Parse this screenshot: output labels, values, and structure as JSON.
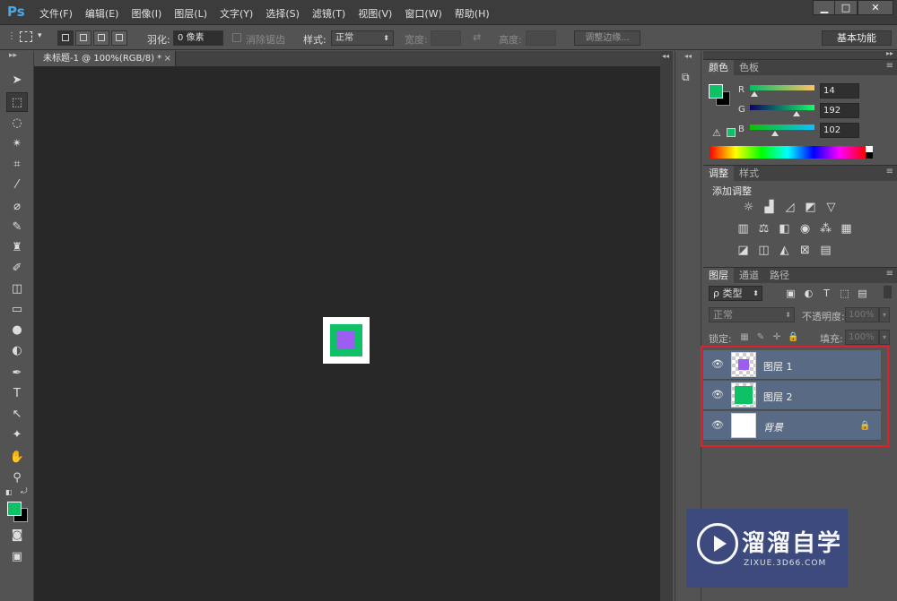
{
  "app": {
    "logo_text": "Ps",
    "menus": [
      "文件(F)",
      "编辑(E)",
      "图像(I)",
      "图层(L)",
      "文字(Y)",
      "选择(S)",
      "滤镜(T)",
      "视图(V)",
      "窗口(W)",
      "帮助(H)"
    ],
    "window_controls": [
      "▁",
      "□",
      "✕"
    ]
  },
  "options_bar": {
    "feather_label": "羽化:",
    "feather_value": "0 像素",
    "antialias_label": "消除锯齿",
    "style_label": "样式:",
    "style_value": "正常",
    "width_label": "宽度:",
    "height_label": "高度:",
    "refine_edge_label": "调整边缘...",
    "workspace_label": "基本功能"
  },
  "document": {
    "tab_title": "未标题-1 @ 100%(RGB/8) *",
    "tab_close": "×"
  },
  "colors": {
    "foreground": "#0ec066",
    "background": "#000000",
    "square_outer": "#0ec066",
    "square_inner": "#9b5ef0",
    "accent_highlight": "#e0202a"
  },
  "color_panel": {
    "tabs": [
      "颜色",
      "色板"
    ],
    "channels": [
      {
        "label": "R",
        "value": "14"
      },
      {
        "label": "G",
        "value": "192"
      },
      {
        "label": "B",
        "value": "102"
      }
    ]
  },
  "adjustments_panel": {
    "tabs": [
      "调整",
      "样式"
    ],
    "title": "添加调整"
  },
  "layers_panel": {
    "tabs": [
      "图层",
      "通道",
      "路径"
    ],
    "filter_label": "ρ 类型",
    "blend_mode": "正常",
    "opacity_label": "不透明度:",
    "opacity_value": "100%",
    "lock_label": "锁定:",
    "fill_label": "填充:",
    "fill_value": "100%",
    "layers": [
      {
        "name": "图层 1",
        "thumb": "purple"
      },
      {
        "name": "图层 2",
        "thumb": "green"
      },
      {
        "name": "背景",
        "thumb": "white",
        "locked": true
      }
    ]
  },
  "watermark": {
    "title": "溜溜自学",
    "subtitle": "ZIXUE.3D66.COM"
  }
}
